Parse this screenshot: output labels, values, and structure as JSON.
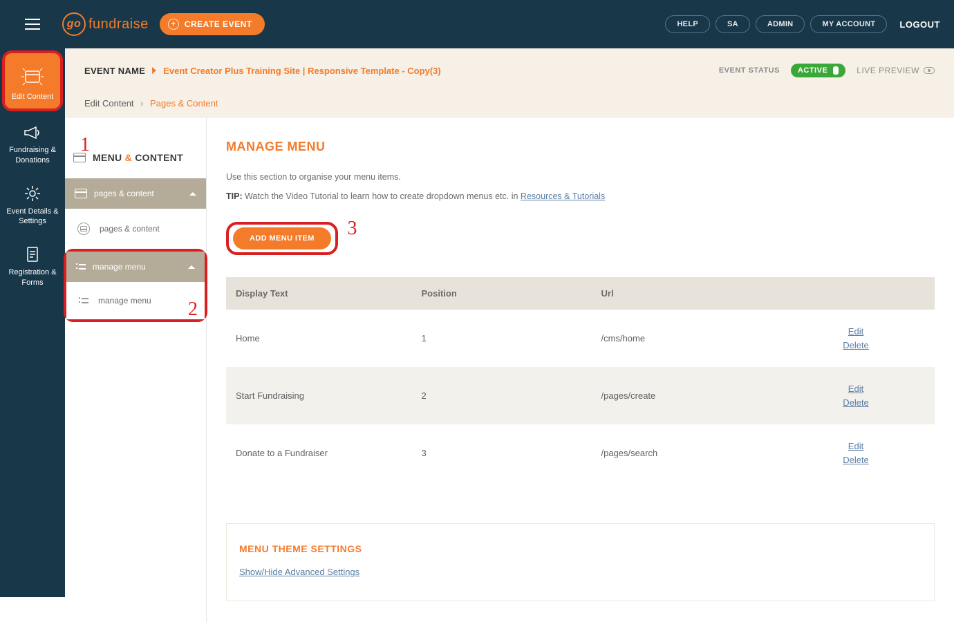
{
  "topnav": {
    "logo_text": "fundraise",
    "logo_go": "go",
    "create_event": "CREATE EVENT",
    "help": "HELP",
    "sa": "SA",
    "admin": "ADMIN",
    "my_account": "MY ACCOUNT",
    "logout": "LOGOUT"
  },
  "rail": {
    "edit_content": "Edit Content",
    "fundraising": "Fundraising & Donations",
    "event_details": "Event Details & Settings",
    "registration": "Registration & Forms"
  },
  "sidebar": {
    "header_menu": "MENU",
    "header_amp": "&",
    "header_content": "CONTENT",
    "pages_content_head": "pages & content",
    "pages_content_item": "pages & content",
    "manage_menu_head": "manage menu",
    "manage_menu_item": "manage menu"
  },
  "infobar": {
    "event_name_label": "EVENT NAME",
    "event_title": "Event Creator Plus Training Site | Responsive Template - Copy(3)",
    "event_status_label": "EVENT STATUS",
    "status": "ACTIVE",
    "live_preview": "LIVE PREVIEW"
  },
  "breadcrumb": {
    "root": "Edit Content",
    "current": "Pages & Content"
  },
  "page": {
    "title": "MANAGE MENU",
    "intro": "Use this section to organise your menu items.",
    "tip_label": "TIP:",
    "tip_text": " Watch the Video Tutorial to learn how to create dropdown menus etc. in ",
    "tip_link": "Resources & Tutorials",
    "add_menu": "ADD MENU ITEM",
    "settings_title": "MENU THEME SETTINGS",
    "settings_link": "Show/Hide Advanced Settings"
  },
  "table": {
    "headers": {
      "display": "Display Text",
      "position": "Position",
      "url": "Url"
    },
    "rows": [
      {
        "display": "Home",
        "position": "1",
        "url": "/cms/home"
      },
      {
        "display": "Start Fundraising",
        "position": "2",
        "url": "/pages/create"
      },
      {
        "display": "Donate to a Fundraiser",
        "position": "3",
        "url": "/pages/search"
      }
    ],
    "actions": {
      "edit": "Edit",
      "delete": "Delete"
    }
  },
  "annotations": {
    "one": "1",
    "two": "2",
    "three": "3"
  }
}
